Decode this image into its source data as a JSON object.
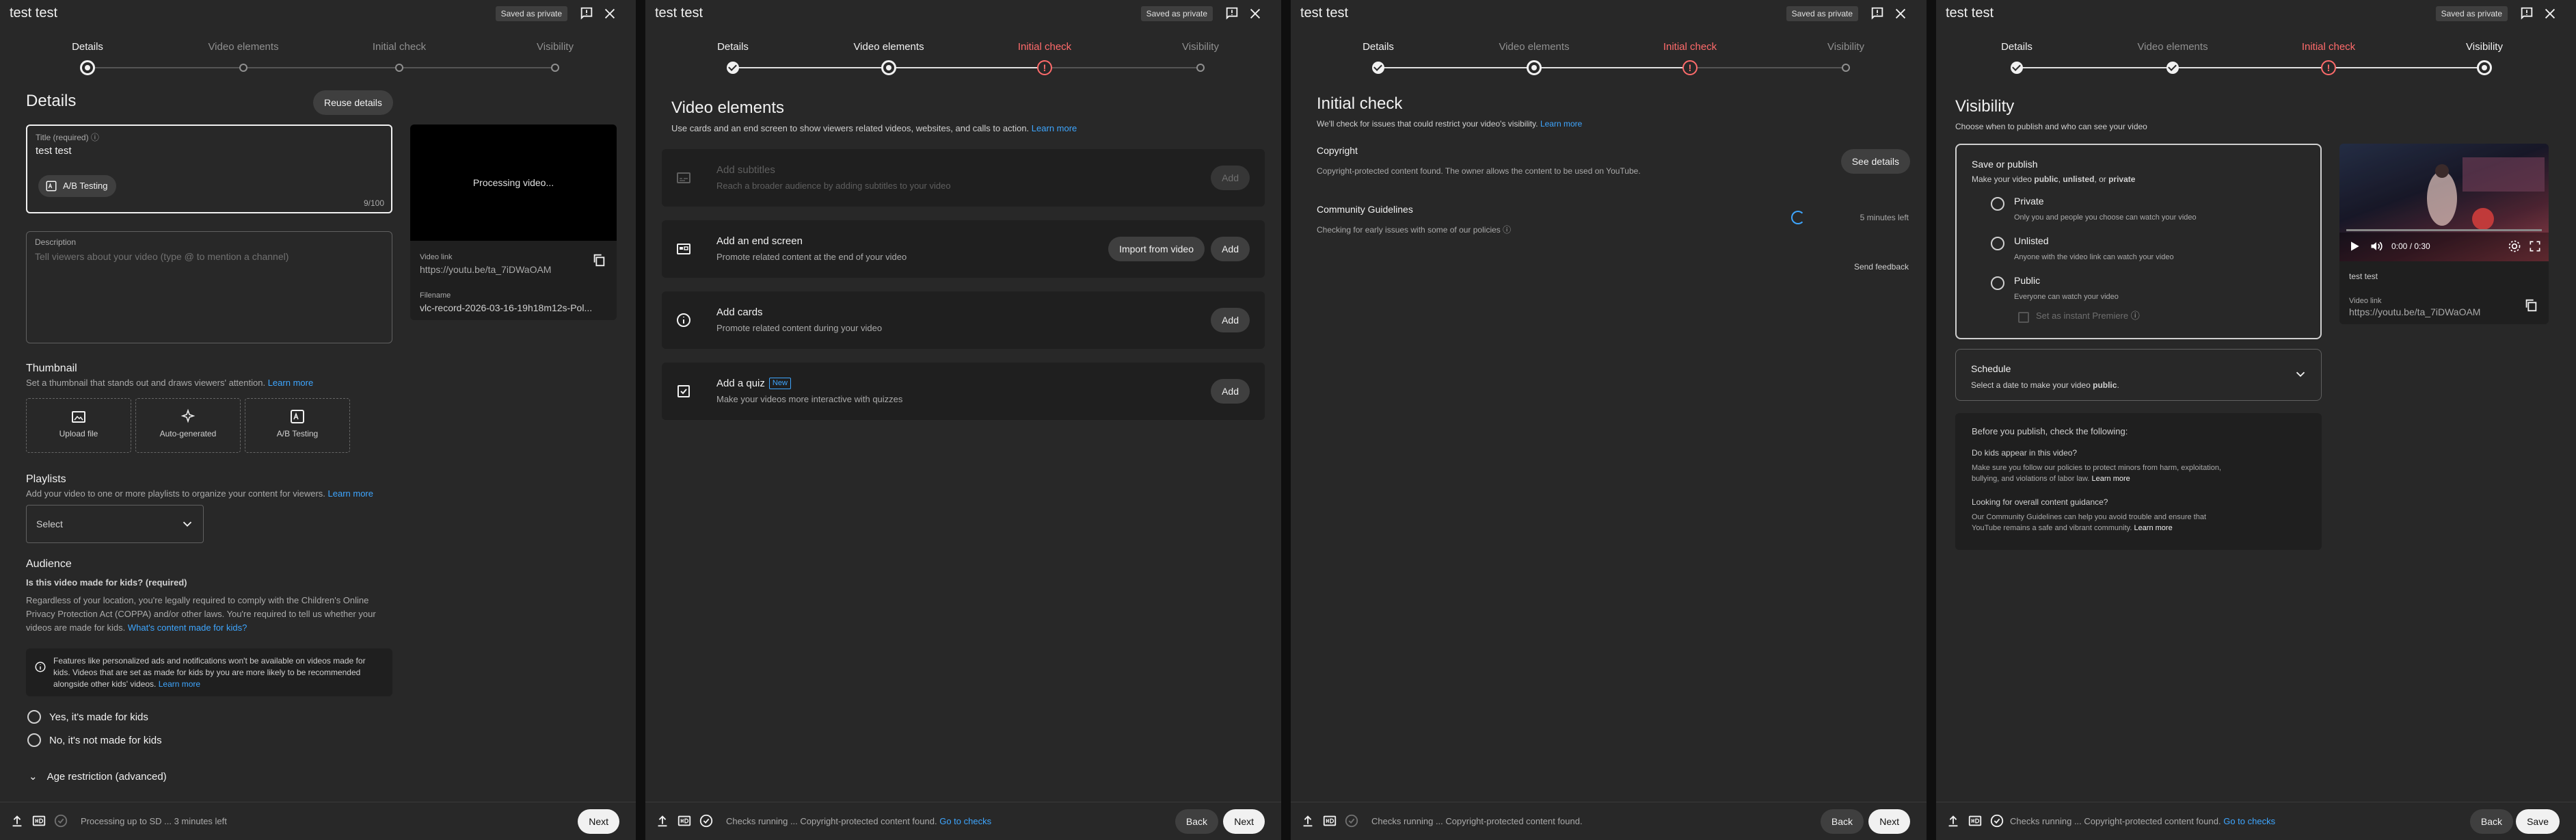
{
  "title": "test test",
  "saved_badge": "Saved as private",
  "steps": [
    "Details",
    "Video elements",
    "Initial check",
    "Visibility"
  ],
  "buttons": {
    "next": "Next",
    "back": "Back",
    "save": "Save"
  },
  "details": {
    "heading": "Details",
    "reuse_button": "Reuse details",
    "title_label": "Title (required)",
    "title_value": "test test",
    "title_counter": "9/100",
    "ab_chip": "A/B Testing",
    "description_label": "Description",
    "description_placeholder": "Tell viewers about your video (type @ to mention a channel)",
    "thumbnail_title": "Thumbnail",
    "thumbnail_text": "Set a thumbnail that stands out and draws viewers' attention.",
    "learn_more": "Learn more",
    "thumb_options": [
      "Upload file",
      "Auto-generated",
      "A/B Testing"
    ],
    "playlists_title": "Playlists",
    "playlists_text": "Add your video to one or more playlists to organize your content for viewers.",
    "playlist_select": "Select",
    "audience_title": "Audience",
    "audience_question": "Is this video made for kids? (required)",
    "audience_text_1": "Regardless of your location, you're legally required to comply with the Children's Online",
    "audience_text_2": "Privacy Protection Act (COPPA) and/or other laws. You're required to tell us whether your",
    "audience_text_3": "videos are made for kids.",
    "audience_link": "What's content made for kids?",
    "info_1": "Features like personalized ads and notifications won't be available on videos made for",
    "info_2": "kids. Videos that are set as made for kids by you are more likely to be recommended",
    "info_3": "alongside other kids' videos.",
    "kids_yes": "Yes, it's made for kids",
    "kids_no": "No, it's not made for kids",
    "age_restriction": "Age restriction (advanced)",
    "processing_video": "Processing video...",
    "video_link_label": "Video link",
    "video_link": "https://youtu.be/ta_7iDWaOAM",
    "filename_label": "Filename",
    "filename": "vlc-record-2026-03-16-19h18m12s-Pol...",
    "status": "Processing up to SD ... 3 minutes left"
  },
  "video_elements": {
    "heading": "Video elements",
    "subtitle": "Use cards and an end screen to show viewers related videos, websites, and calls to action.",
    "learn_more": "Learn more",
    "items": [
      {
        "title": "Add subtitles",
        "sub": "Reach a broader audience by adding subtitles to your video",
        "button": "Add"
      },
      {
        "title": "Add an end screen",
        "sub": "Promote related content at the end of your video",
        "button": "Add",
        "import": "Import from video"
      },
      {
        "title": "Add cards",
        "sub": "Promote related content during your video",
        "button": "Add"
      },
      {
        "title": "Add a quiz",
        "badge": "New",
        "sub": "Make your videos more interactive with quizzes",
        "button": "Add"
      }
    ],
    "status": "Checks running ... Copyright-protected content found.",
    "status_link": "Go to checks"
  },
  "initial_check": {
    "heading": "Initial check",
    "subtitle": "We'll check for issues that could restrict your video's visibility.",
    "learn_more": "Learn more",
    "copyright_title": "Copyright",
    "copyright_text": "Copyright-protected content found. The owner allows the content to be used on YouTube.",
    "see_details": "See details",
    "cg_title": "Community Guidelines",
    "cg_text": "Checking for early issues with some of our policies",
    "time_left": "5 minutes left",
    "send_feedback": "Send feedback",
    "status": "Checks running ... Copyright-protected content found."
  },
  "visibility": {
    "heading": "Visibility",
    "subtitle": "Choose when to publish and who can see your video",
    "save_publish_title": "Save or publish",
    "save_publish_text_1": "Make your video ",
    "opt_public": "public",
    "opt_unlisted": "unlisted",
    "opt_private": "private",
    "sep": ", ",
    "or": ", or ",
    "options": [
      {
        "label": "Private",
        "sub": "Only you and people you choose can watch your video"
      },
      {
        "label": "Unlisted",
        "sub": "Anyone with the video link can watch your video"
      },
      {
        "label": "Public",
        "sub": "Everyone can watch your video"
      }
    ],
    "premiere": "Set as instant Premiere",
    "schedule_title": "Schedule",
    "schedule_text_1": "Select a date to make your video ",
    "schedule_public": "public",
    "schedule_dot": ".",
    "before_title": "Before you publish, check the following:",
    "kids_q": "Do kids appear in this video?",
    "kids_a_1": "Make sure you follow our policies to protect minors from harm, exploitation,",
    "kids_a_2": "bullying, and violations of labor law.",
    "guidance_q": "Looking for overall content guidance?",
    "guidance_a_1": "Our Community Guidelines can help you avoid trouble and ensure that",
    "guidance_a_2": "YouTube remains a safe and vibrant community.",
    "learn_more": "Learn more",
    "player_time": "0:00 / 0:30",
    "video_title": "test test",
    "video_link_label": "Video link",
    "video_link": "https://youtu.be/ta_7iDWaOAM",
    "status": "Checks running ... Copyright-protected content found.",
    "status_link": "Go to checks"
  },
  "icons": [
    "feedback-icon",
    "close-icon",
    "help-icon",
    "copy-icon",
    "upload-icon",
    "hd-icon",
    "check-circle-icon",
    "chevron-down-icon",
    "subtitles-icon",
    "end-screen-icon",
    "info-icon",
    "quiz-icon",
    "play-icon",
    "volume-icon",
    "settings-icon",
    "fullscreen-icon"
  ]
}
